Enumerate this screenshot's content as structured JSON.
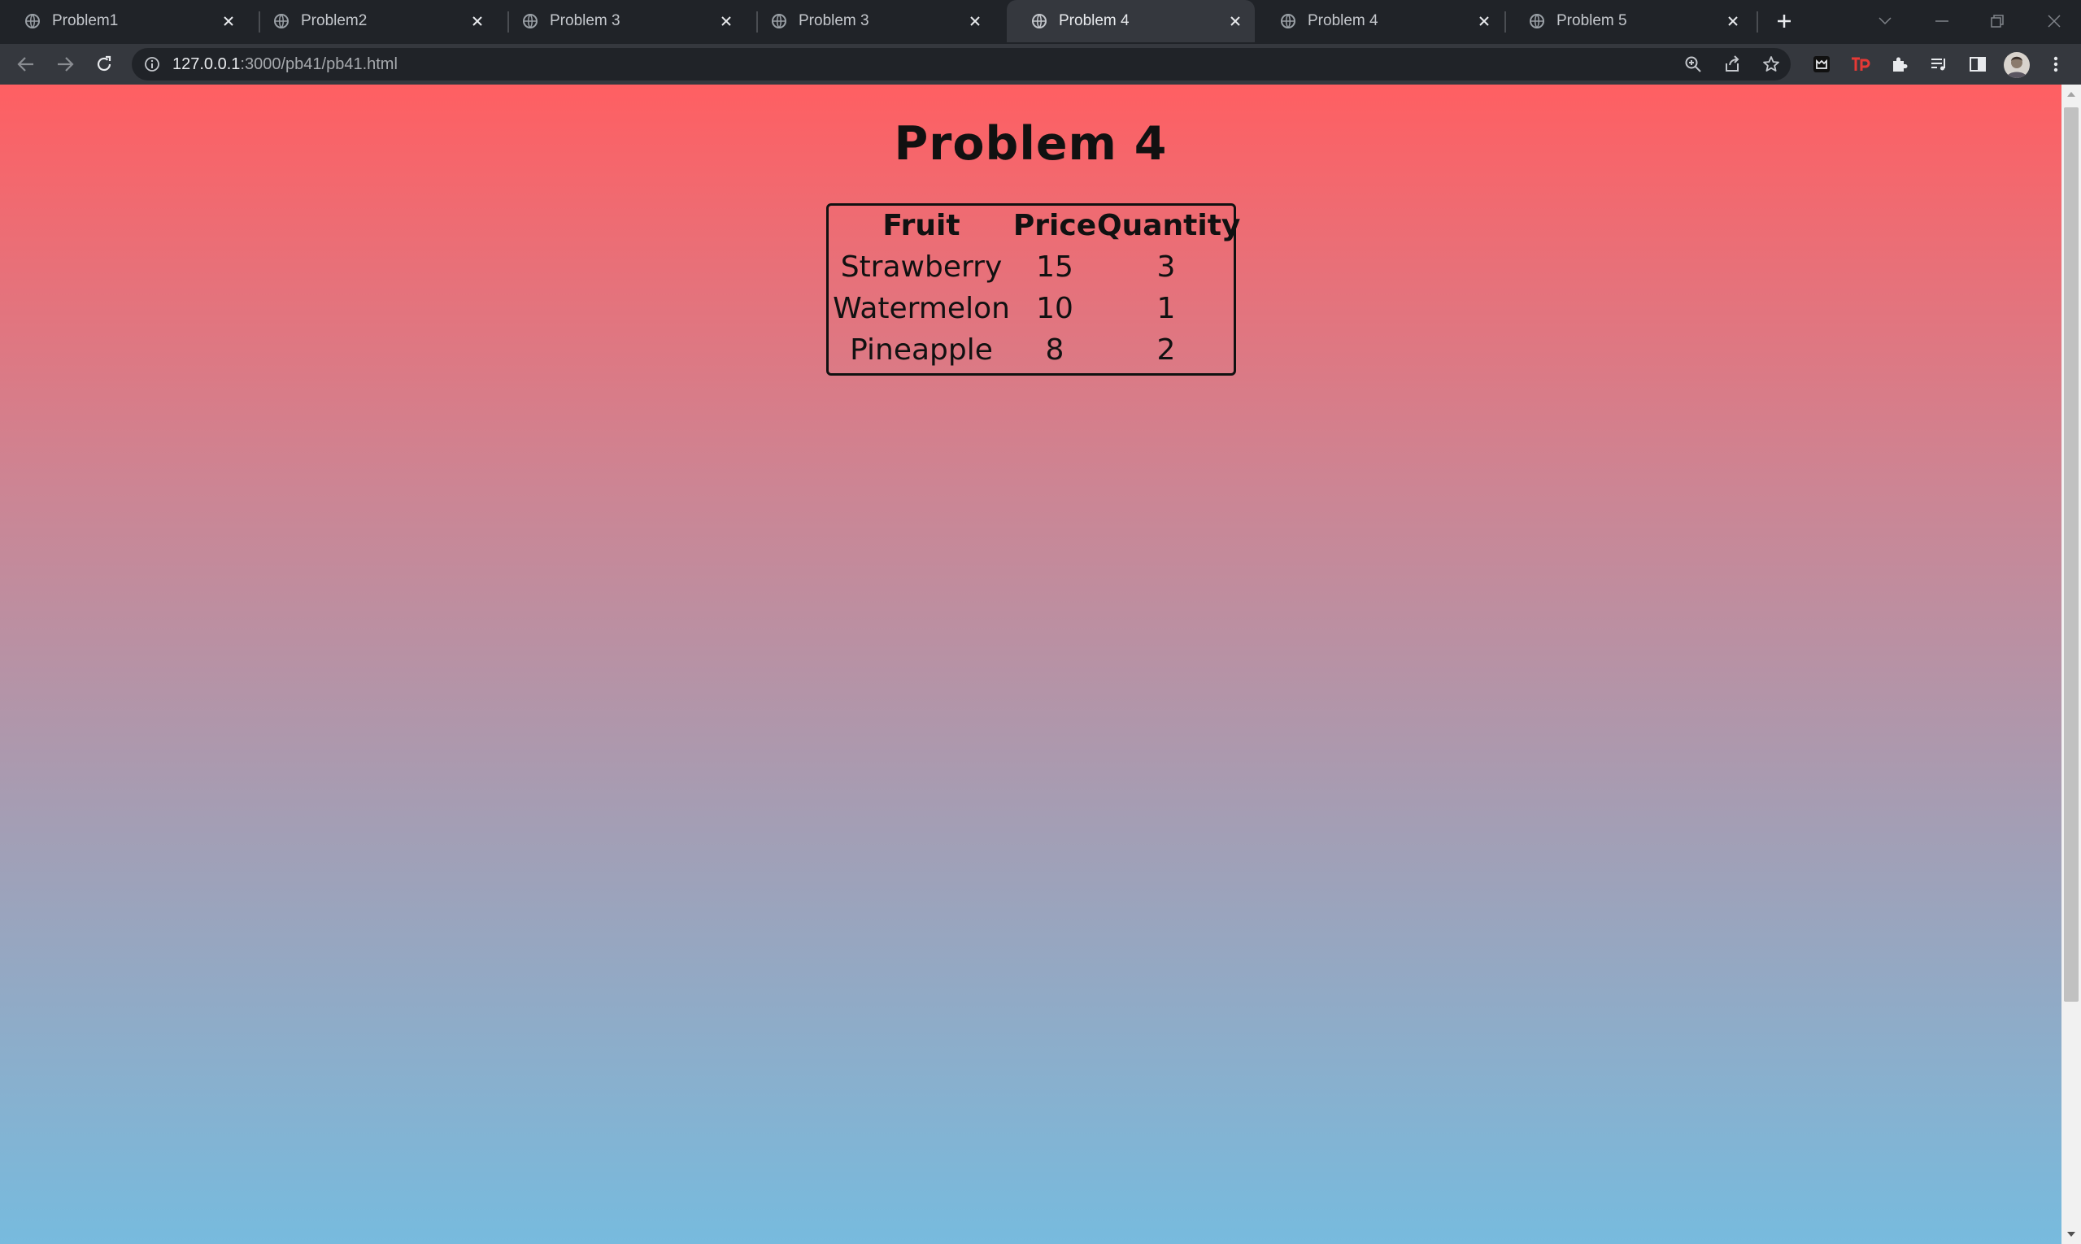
{
  "browser": {
    "tabs": [
      {
        "label": "Problem1",
        "active": false
      },
      {
        "label": "Problem2",
        "active": false
      },
      {
        "label": "Problem 3",
        "active": false
      },
      {
        "label": "Problem 3",
        "active": false
      },
      {
        "label": "Problem 4",
        "active": true
      },
      {
        "label": "Problem 4",
        "active": false
      },
      {
        "label": "Problem 5",
        "active": false
      }
    ],
    "url_host": "127.0.0.1",
    "url_path": ":3000/pb41/pb41.html"
  },
  "page": {
    "title": "Problem 4",
    "table": {
      "headers": [
        "Fruit",
        "Price",
        "Quantity"
      ],
      "rows": [
        [
          "Strawberry",
          "15",
          "3"
        ],
        [
          "Watermelon",
          "10",
          "1"
        ],
        [
          "Pineapple",
          "8",
          "2"
        ]
      ]
    }
  },
  "colors": {
    "gradient_top": "#ff5f62",
    "gradient_bottom": "#77bbde",
    "tab_strip": "#202328",
    "toolbar": "#35383e"
  }
}
